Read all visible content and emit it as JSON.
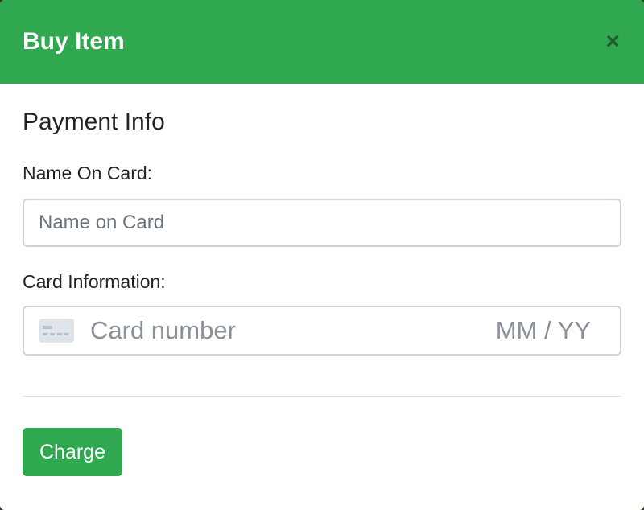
{
  "modal": {
    "title": "Buy Item",
    "close_label": "×"
  },
  "payment": {
    "section_title": "Payment Info",
    "name_label": "Name On Card:",
    "name_placeholder": "Name on Card",
    "name_value": "",
    "card_label": "Card Information:",
    "card_number_placeholder": "Card number",
    "card_expiry_placeholder": "MM / YY",
    "card_icon": "credit-card-icon"
  },
  "actions": {
    "charge_label": "Charge"
  },
  "colors": {
    "header_bg": "#2fa84f",
    "button_bg": "#2fa84f",
    "close_color": "#1d5c30"
  }
}
